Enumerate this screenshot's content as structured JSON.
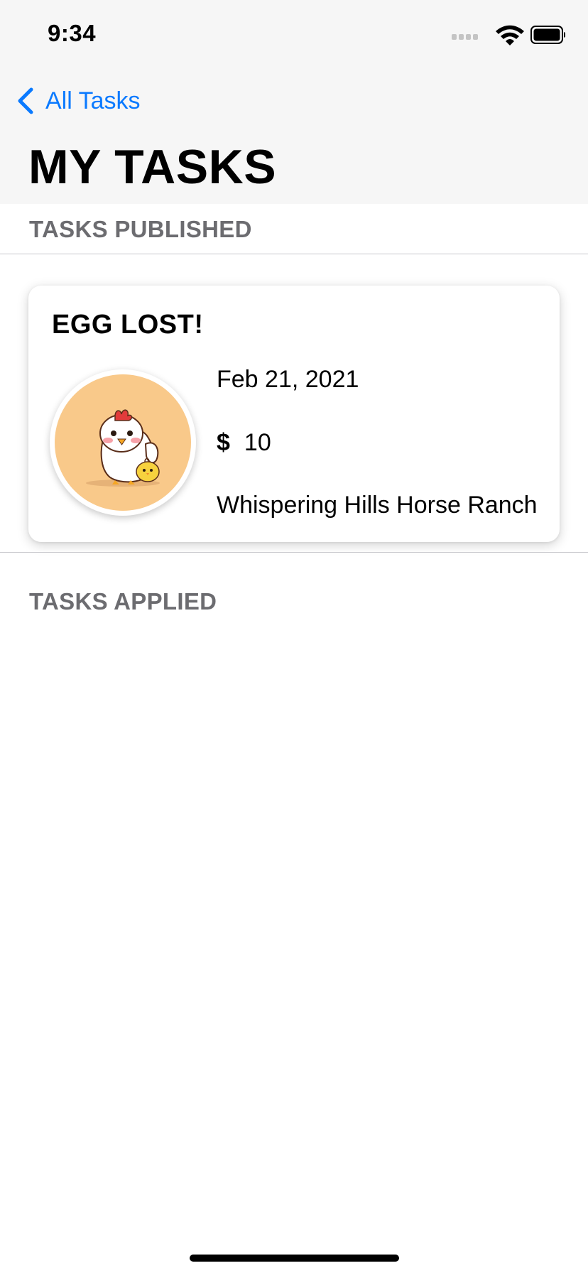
{
  "status_bar": {
    "time": "9:34"
  },
  "nav": {
    "back_label": "All Tasks",
    "title": "MY TASKS"
  },
  "sections": {
    "published_header": "TASKS PUBLISHED",
    "applied_header": "TASKS APPLIED"
  },
  "published_tasks": [
    {
      "title": "EGG LOST!",
      "date": "Feb 21, 2021",
      "currency_symbol": "$",
      "price": "10",
      "location": "Whispering Hills Horse Ranch",
      "image_icon": "chicken-avatar"
    }
  ],
  "colors": {
    "accent": "#0a7aff",
    "header_bg": "#f6f6f6",
    "section_text": "#6c6c70",
    "avatar_bg": "#f9c98a"
  }
}
